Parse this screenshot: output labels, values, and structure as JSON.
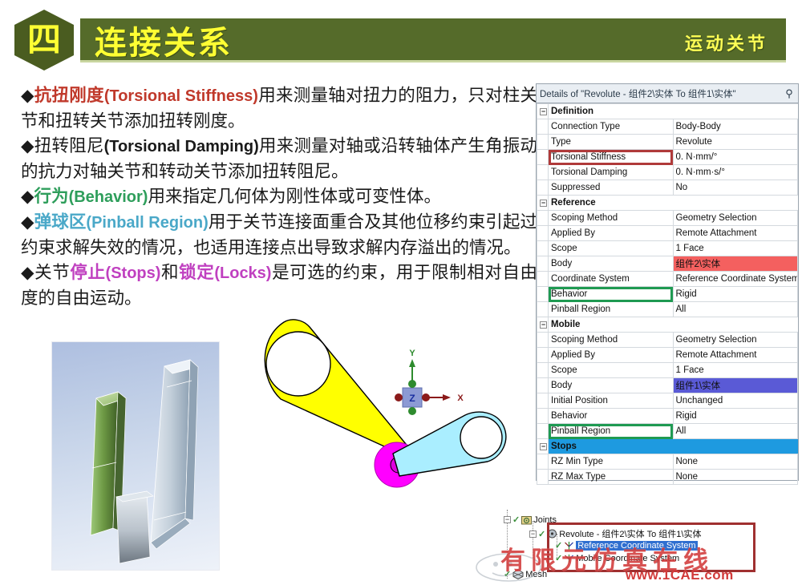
{
  "header": {
    "badge_number": "四",
    "title": "连接关系",
    "subtitle": "运动关节"
  },
  "content": {
    "bullet_char": "◆",
    "paragraphs": [
      {
        "kw": "抗扭刚度",
        "kw_color": "#c0392b",
        "kw_en": "(Torsional  Stiffness)",
        "rest": "用来测量轴对扭力的阻力，只对柱关节和扭转关节添加扭转刚度。"
      },
      {
        "kw": "扭转阻尼",
        "kw_color": "#1a1a1a",
        "kw_en": "(Torsional Damping)",
        "rest": "用来测量对轴或沿转轴体产生角振动的抗力对轴关节和转动关节添加扭转阻尼。"
      },
      {
        "kw": "行为",
        "kw_color": "#2e9e5b",
        "kw_en": "(Behavior)",
        "rest": "用来指定几何体为刚性体或可变性体。"
      },
      {
        "kw": "弹球区",
        "kw_color": "#4aa8c8",
        "kw_en": "(Pinball Region)",
        "rest": "用于关节连接面重合及其他位移约束引起过约束求解失效的情况，也适用连接点出导致求解内存溢出的情况。"
      }
    ],
    "last_paragraph": {
      "prefix": "关节",
      "kw1": "停止",
      "kw1_en": "(Stops)",
      "mid": "和",
      "kw2": "锁定",
      "kw2_en": "(Locks)",
      "rest": "是可选的约束，用于限制相对自由度的自由运动。"
    }
  },
  "details_panel": {
    "title": "Details of \"Revolute - 组件2\\实体 To 组件1\\实体\"",
    "pin_glyph": "⚲",
    "collapse_glyph": "−",
    "rows": [
      {
        "kind": "section",
        "label": "Definition"
      },
      {
        "kind": "row",
        "label": "Connection Type",
        "value": "Body-Body"
      },
      {
        "kind": "row",
        "label": "Type",
        "value": "Revolute"
      },
      {
        "kind": "row",
        "label": "Torsional Stiffness",
        "value": "0. N·mm/°",
        "label_box": "red"
      },
      {
        "kind": "row",
        "label": "Torsional Damping",
        "value": "0. N·mm·s/°"
      },
      {
        "kind": "row",
        "label": "Suppressed",
        "value": "No"
      },
      {
        "kind": "section",
        "label": "Reference"
      },
      {
        "kind": "row",
        "label": "Scoping Method",
        "value": "Geometry Selection"
      },
      {
        "kind": "row",
        "label": "Applied By",
        "value": "Remote Attachment"
      },
      {
        "kind": "row",
        "label": "Scope",
        "value": "1 Face"
      },
      {
        "kind": "row",
        "label": "Body",
        "value": "组件2\\实体",
        "value_hl": "red"
      },
      {
        "kind": "row",
        "label": "Coordinate System",
        "value": "Reference Coordinate System"
      },
      {
        "kind": "row",
        "label": "Behavior",
        "value": "Rigid",
        "label_box": "green"
      },
      {
        "kind": "row",
        "label": "Pinball Region",
        "value": "All"
      },
      {
        "kind": "section",
        "label": "Mobile"
      },
      {
        "kind": "row",
        "label": "Scoping Method",
        "value": "Geometry Selection"
      },
      {
        "kind": "row",
        "label": "Applied By",
        "value": "Remote Attachment"
      },
      {
        "kind": "row",
        "label": "Scope",
        "value": "1 Face"
      },
      {
        "kind": "row",
        "label": "Body",
        "value": "组件1\\实体",
        "value_hl": "blue"
      },
      {
        "kind": "row",
        "label": "Initial Position",
        "value": "Unchanged"
      },
      {
        "kind": "row",
        "label": "Behavior",
        "value": "Rigid"
      },
      {
        "kind": "row",
        "label": "Pinball Region",
        "value": "All",
        "label_box": "green"
      },
      {
        "kind": "section",
        "label": "Stops",
        "hl": "stops"
      },
      {
        "kind": "row",
        "label": "RZ Min Type",
        "value": "None"
      },
      {
        "kind": "row",
        "label": "RZ Max Type",
        "value": "None"
      }
    ]
  },
  "viewport": {
    "axis_triad": {
      "x_label": "X",
      "y_label": "Y",
      "z_label": "Z"
    },
    "parts": [
      {
        "name": "reference-link",
        "color": "#ffff00"
      },
      {
        "name": "mobile-link",
        "color": "#aaeeff"
      },
      {
        "name": "revolute-joint-marker",
        "color": "#ff00ff"
      }
    ]
  },
  "tree": {
    "nodes": [
      {
        "label": "Joints",
        "depth": 0,
        "icon": "folder-joints-icon",
        "expander": "−"
      },
      {
        "label": "Revolute - 组件2\\实体 To 组件1\\实体",
        "depth": 1,
        "icon": "joint-icon",
        "expander": "−"
      },
      {
        "label": "Reference Coordinate System",
        "depth": 2,
        "icon": "coordinate-system-icon",
        "selected": true
      },
      {
        "label": "Mobile Coordinate System",
        "depth": 2,
        "icon": "coordinate-system-icon"
      },
      {
        "label": "Mesh",
        "depth": 0,
        "icon": "mesh-icon"
      }
    ]
  },
  "watermark": {
    "text_cn": "有限元仿真在线",
    "url": "www.1CAE.com",
    "color": "#d23b3b"
  },
  "colors": {
    "banner_green": "#556b2a",
    "badge_green": "#4a5c20",
    "banner_yellow": "#ffff33",
    "highlight_red": "#f4605f",
    "highlight_blue": "#5a5ad6",
    "stops_blue": "#1e9ae0",
    "box_red": "#b03a3a",
    "box_green": "#1f9a52"
  }
}
